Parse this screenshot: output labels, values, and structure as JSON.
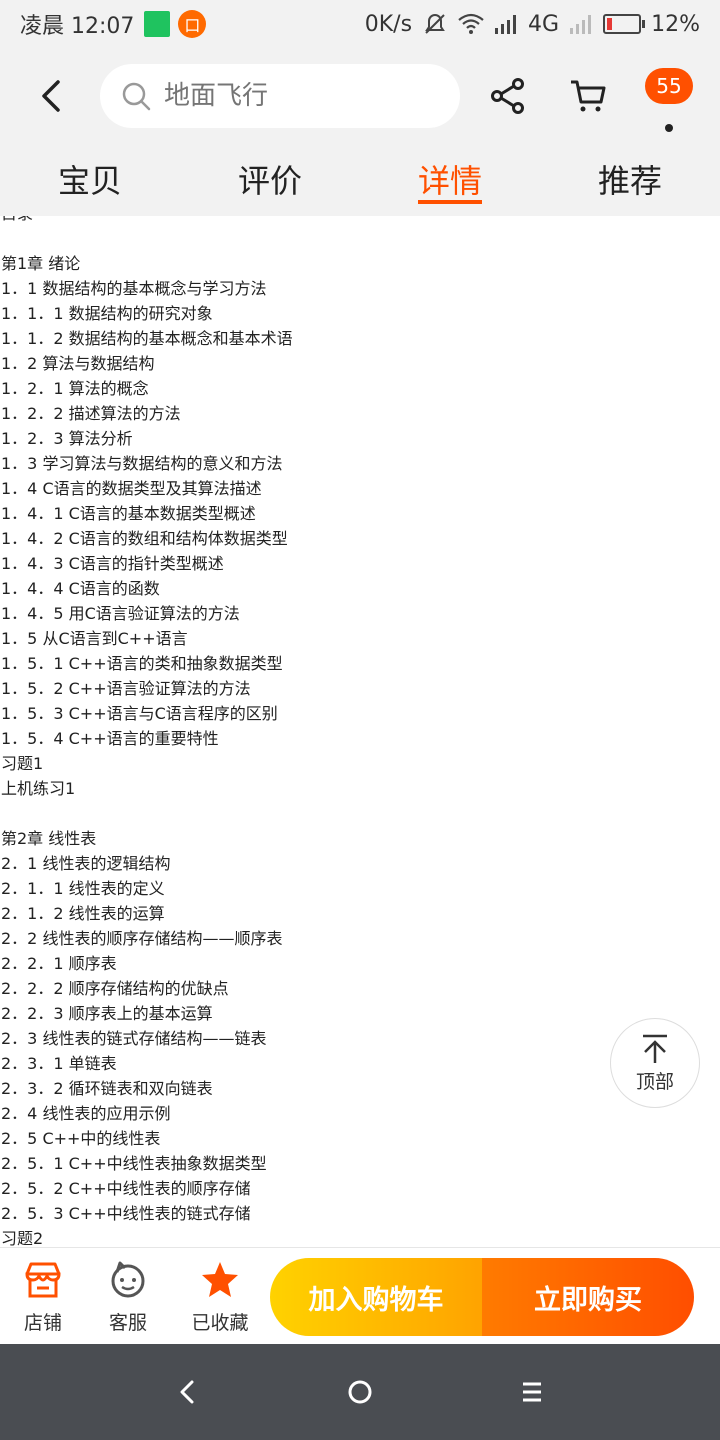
{
  "status_bar": {
    "time": "凌晨 12:07",
    "app_icon_char": "口",
    "network_speed": "0K/s",
    "network_type": "4G",
    "battery": "12%"
  },
  "header": {
    "search": {
      "placeholder": "地面飞行"
    },
    "cart_badge": "55",
    "tabs": [
      {
        "label": "宝贝",
        "active": false
      },
      {
        "label": "评价",
        "active": false
      },
      {
        "label": "详情",
        "active": true
      },
      {
        "label": "推荐",
        "active": false
      }
    ]
  },
  "content": {
    "lines": [
      "目录",
      "",
      "第1章 绪论",
      "1．1 数据结构的基本概念与学习方法",
      "1．1．1 数据结构的研究对象",
      "1．1．2 数据结构的基本概念和基本术语",
      "1．2 算法与数据结构",
      "1．2．1 算法的概念",
      "1．2．2 描述算法的方法",
      "1．2．3 算法分析",
      "1．3 学习算法与数据结构的意义和方法",
      "1．4 C语言的数据类型及其算法描述",
      "1．4．1 C语言的基本数据类型概述",
      "1．4．2 C语言的数组和结构体数据类型",
      "1．4．3 C语言的指针类型概述",
      "1．4．4 C语言的函数",
      "1．4．5 用C语言验证算法的方法",
      "1．5 从C语言到C++语言",
      "1．5．1 C++语言的类和抽象数据类型",
      "1．5．2 C++语言验证算法的方法",
      "1．5．3 C++语言与C语言程序的区别",
      "1．5．4 C++语言的重要特性",
      "习题1",
      "上机练习1",
      "",
      "第2章 线性表",
      "2．1 线性表的逻辑结构",
      "2．1．1 线性表的定义",
      "2．1．2 线性表的运算",
      "2．2 线性表的顺序存储结构——顺序表",
      "2．2．1 顺序表",
      "2．2．2 顺序存储结构的优缺点",
      "2．2．3 顺序表上的基本运算",
      "2．3 线性表的链式存储结构——链表",
      "2．3．1 单链表",
      "2．3．2 循环链表和双向链表",
      "2．4 线性表的应用示例",
      "2．5 C++中的线性表",
      "2．5．1 C++中线性表抽象数据类型",
      "2．5．2 C++中线性表的顺序存储",
      "2．5．3 C++中线性表的链式存储",
      "习题2"
    ]
  },
  "back_to_top": {
    "label": "顶部"
  },
  "bottom_bar": {
    "shop_label": "店铺",
    "service_label": "客服",
    "favorite_label": "已收藏",
    "add_to_cart_label": "加入购物车",
    "buy_now_label": "立即购买"
  },
  "colors": {
    "accent": "#ff5000",
    "cart_gradient_start": "#ffd200",
    "cart_gradient_end": "#ffa300",
    "buy_gradient_start": "#ff7b00",
    "buy_gradient_end": "#ff4e00",
    "nav_bar": "#4a4d52"
  }
}
